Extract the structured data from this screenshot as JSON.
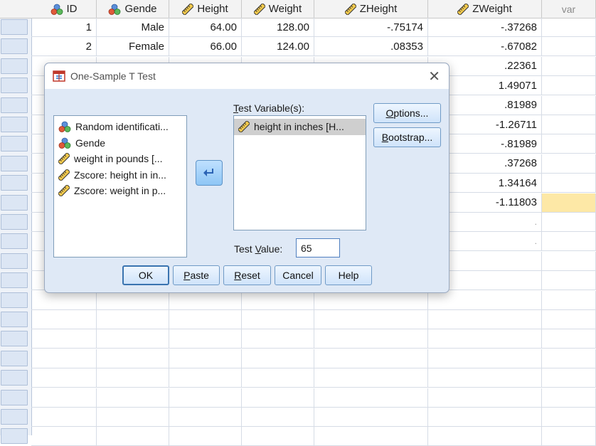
{
  "columns": [
    {
      "name": "ID",
      "icon": "nominal-icon"
    },
    {
      "name": "Gende",
      "icon": "nominal-icon"
    },
    {
      "name": "Height",
      "icon": "scale-ruler-icon"
    },
    {
      "name": "Weight",
      "icon": "scale-ruler-icon"
    },
    {
      "name": "ZHeight",
      "icon": "scale-ruler-icon"
    },
    {
      "name": "ZWeight",
      "icon": "scale-ruler-icon"
    },
    {
      "name": "var",
      "icon": ""
    }
  ],
  "rows": [
    {
      "ID": "1",
      "Gende": "Male",
      "Height": "64.00",
      "Weight": "128.00",
      "ZHeight": "-.75174",
      "ZWeight": "-.37268"
    },
    {
      "ID": "2",
      "Gende": "Female",
      "Height": "66.00",
      "Weight": "124.00",
      "ZHeight": ".08353",
      "ZWeight": "-.67082"
    },
    {
      "ZWeight": ".22361"
    },
    {
      "ZWeight": "1.49071"
    },
    {
      "ZWeight": ".81989"
    },
    {
      "ZWeight": "-1.26711"
    },
    {
      "ZWeight": "-.81989"
    },
    {
      "ZWeight": ".37268"
    },
    {
      "ZWeight": "1.34164"
    },
    {
      "ZWeight": "-1.11803"
    },
    {
      "ZWeight": "."
    },
    {
      "ZWeight": "."
    }
  ],
  "dialog": {
    "title": "One-Sample T Test",
    "source_list": [
      {
        "label": "Random identificati...",
        "icon": "nominal-icon"
      },
      {
        "label": "Gende",
        "icon": "nominal-icon"
      },
      {
        "label": "weight in pounds [...",
        "icon": "scale-ruler-icon"
      },
      {
        "label": "Zscore:  height in in...",
        "icon": "scale-ruler-icon"
      },
      {
        "label": "Zscore:  weight in p...",
        "icon": "scale-ruler-icon"
      }
    ],
    "test_variables_label_u": "T",
    "test_variables_label_rest": "est Variable(s):",
    "test_variables": [
      {
        "label": "height in inches [H...",
        "icon": "scale-ruler-icon"
      }
    ],
    "test_value_label_pre": "Test ",
    "test_value_label_u": "V",
    "test_value_label_post": "alue:",
    "test_value": "65",
    "options_u": "O",
    "options_rest": "ptions...",
    "bootstrap_u": "B",
    "bootstrap_rest": "ootstrap...",
    "ok_label": "OK",
    "paste_u": "P",
    "paste_rest": "aste",
    "reset_u": "R",
    "reset_rest": "eset",
    "cancel_label": "Cancel",
    "help_label": "Help"
  },
  "colors": {
    "dialog_bg": "#dfe9f6",
    "highlight_cell": "#fde8a6",
    "button_border": "#6f9ac6"
  }
}
